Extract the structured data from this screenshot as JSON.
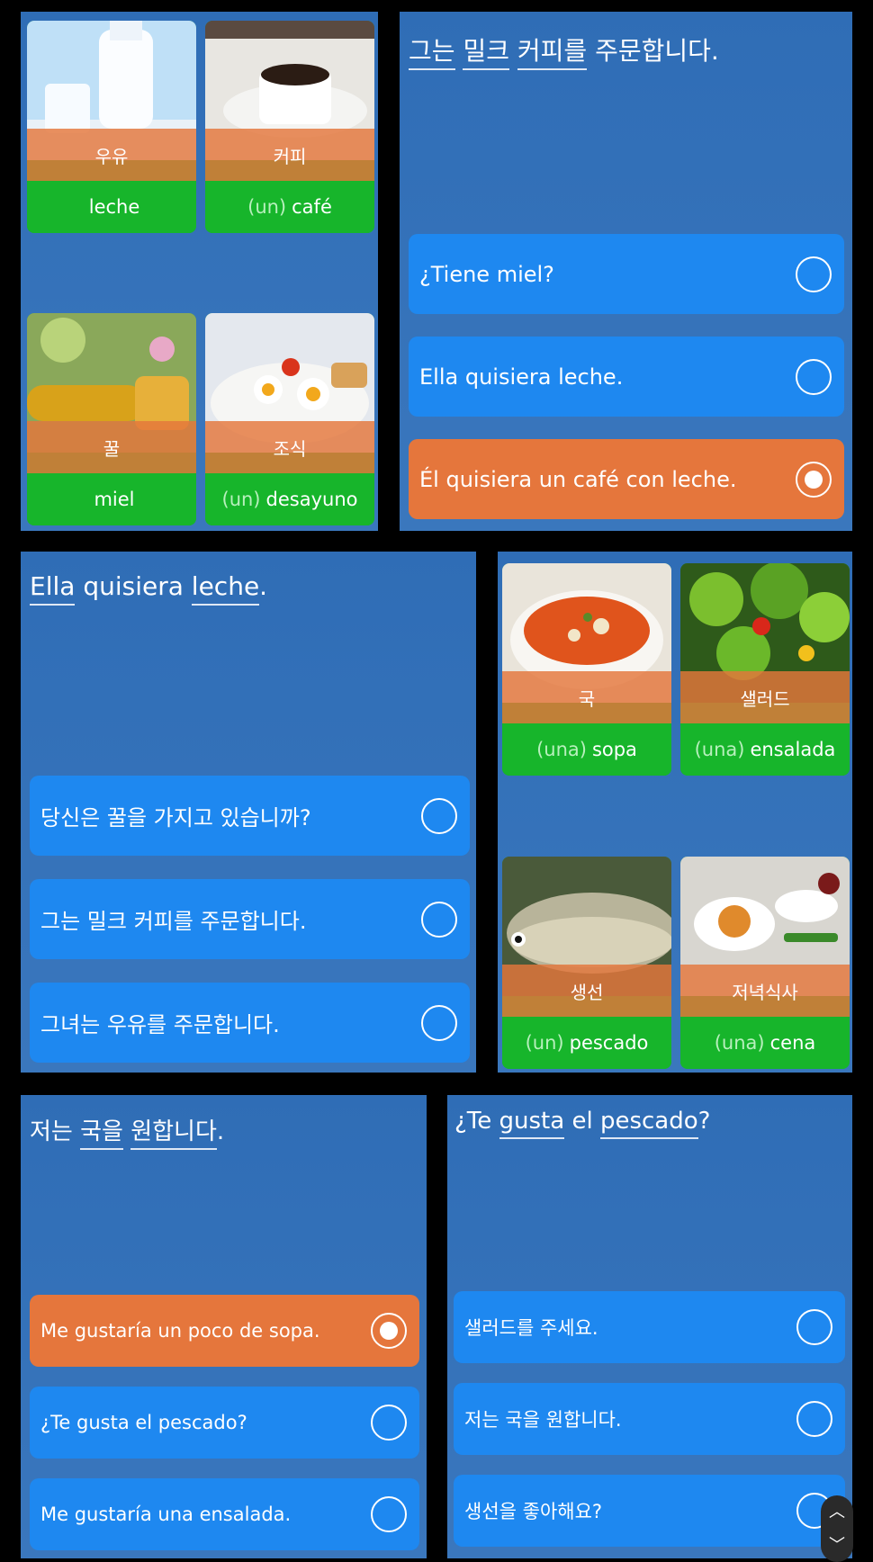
{
  "panel1": {
    "cards": [
      {
        "kr": "우유",
        "article": "",
        "es": "leche",
        "icon": "milk-photo"
      },
      {
        "kr": "커피",
        "article": "(un)",
        "es": "café",
        "icon": "coffee-photo"
      },
      {
        "kr": "꿀",
        "article": "",
        "es": "miel",
        "icon": "honey-photo"
      },
      {
        "kr": "조식",
        "article": "(un)",
        "es": "desayuno",
        "icon": "breakfast-photo"
      }
    ]
  },
  "panel2": {
    "sentence": [
      "그는",
      "밀크",
      "커피를",
      "주문합니다."
    ],
    "options": [
      {
        "label": "¿Tiene miel?",
        "selected": false
      },
      {
        "label": "Ella quisiera leche.",
        "selected": false
      },
      {
        "label": "Él quisiera un café con leche.",
        "selected": true
      }
    ]
  },
  "panel3": {
    "sentence": [
      "Ella",
      "quisiera",
      "leche",
      "."
    ],
    "options": [
      {
        "label": "당신은 꿀을 가지고 있습니까?",
        "selected": false
      },
      {
        "label": "그는 밀크 커피를 주문합니다.",
        "selected": false
      },
      {
        "label": "그녀는 우유를 주문합니다.",
        "selected": false
      }
    ]
  },
  "panel4": {
    "cards": [
      {
        "kr": "국",
        "article": "(una)",
        "es": "sopa",
        "icon": "soup-photo"
      },
      {
        "kr": "샐러드",
        "article": "(una)",
        "es": "ensalada",
        "icon": "salad-photo"
      },
      {
        "kr": "생선",
        "article": "(un)",
        "es": "pescado",
        "icon": "fish-photo"
      },
      {
        "kr": "저녁식사",
        "article": "(una)",
        "es": "cena",
        "icon": "dinner-photo"
      }
    ]
  },
  "panel5": {
    "sentence": [
      "저는",
      "국을",
      "원합니다",
      "."
    ],
    "options": [
      {
        "label": "Me gustaría un poco de sopa.",
        "selected": true
      },
      {
        "label": "¿Te gusta el pescado?",
        "selected": false
      },
      {
        "label": "Me gustaría una ensalada.",
        "selected": false
      }
    ]
  },
  "panel6": {
    "sentence": [
      "¿Te",
      "gusta",
      "el",
      "pescado",
      "?"
    ],
    "options": [
      {
        "label": "샐러드를 주세요.",
        "selected": false
      },
      {
        "label": "저는 국을 원합니다.",
        "selected": false
      },
      {
        "label": "생선을 좋아해요?",
        "selected": false
      }
    ]
  },
  "scroll": {
    "up": "︿",
    "down": "﹀"
  },
  "colors": {
    "panel_bg": "#3471b9",
    "option_blue": "#1e88f0",
    "option_selected": "#e5763c",
    "card_green": "#17b52b",
    "card_label_orange": "#e5763c"
  }
}
